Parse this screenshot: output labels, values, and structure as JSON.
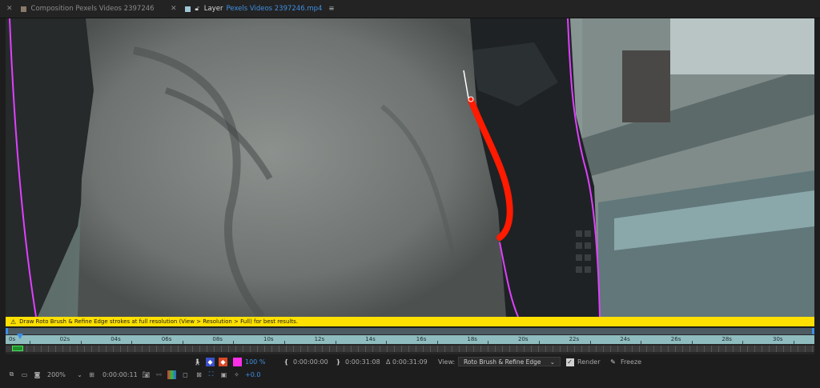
{
  "tabs": {
    "composition": {
      "prefix": "Composition",
      "name": "Pexels Videos 2397246"
    },
    "layer": {
      "prefix": "Layer",
      "name": "Pexels Videos 2397246.mp4"
    }
  },
  "warning": {
    "text": "Draw Roto Brush & Refine Edge strokes at full resolution (View > Resolution > Full) for best results."
  },
  "timeline": {
    "ticks": [
      "0s",
      "02s",
      "04s",
      "06s",
      "08s",
      "10s",
      "12s",
      "14s",
      "16s",
      "18s",
      "20s",
      "22s",
      "24s",
      "26s",
      "28s",
      "30s"
    ]
  },
  "toolbar1": {
    "opacity": "100 %",
    "in_point": "0:00:00:00",
    "out_point": "0:00:31:08",
    "duration": "Δ 0:00:31:09",
    "view_label": "View:",
    "view_value": "Roto Brush & Refine Edge",
    "render_label": "Render",
    "freeze_label": "Freeze"
  },
  "toolbar2": {
    "zoom": "200%",
    "timecode": "0:00:00:11",
    "exposure": "+0.0"
  },
  "colors": {
    "accent": "#3f8fe0",
    "warning": "#ffe000",
    "stroke": "#ff1a00",
    "outline": "#e040ff"
  }
}
